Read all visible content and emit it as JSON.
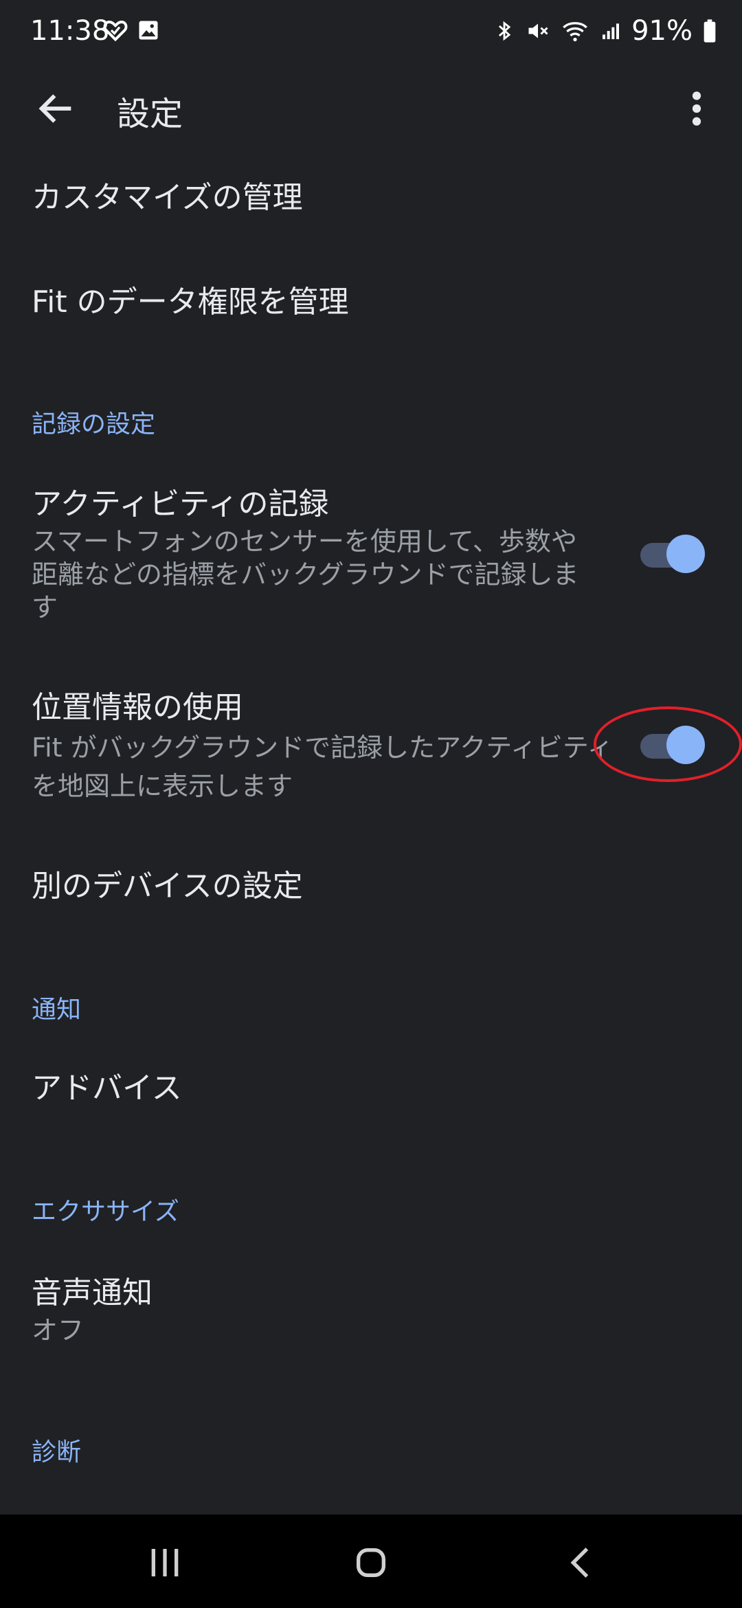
{
  "status_bar": {
    "time": "11:38",
    "battery_percent": "91%",
    "left_icons": [
      "heart-icon",
      "image-icon"
    ],
    "right_icons": [
      "bluetooth-icon",
      "mute-icon",
      "wifi-icon",
      "signal-icon",
      "battery-icon"
    ]
  },
  "app_bar": {
    "title": "設定",
    "back_icon": "arrow-back-icon",
    "menu_icon": "more-vert-icon"
  },
  "items": {
    "customize": {
      "title": "カスタマイズの管理"
    },
    "data_permissions": {
      "title": "Fit のデータ権限を管理"
    },
    "activity_recording": {
      "title": "アクティビティの記録",
      "subtitle": "スマートフォンのセンサーを使用して、歩数や距離などの指標をバックグラウンドで記録します",
      "enabled": true
    },
    "location": {
      "title": "位置情報の使用",
      "subtitle": "Fit がバックグラウンドで記録したアクティビティを地図上に表示します",
      "enabled": true
    },
    "other_device": {
      "title": "別のデバイスの設定"
    },
    "advice": {
      "title": "アドバイス"
    },
    "voice": {
      "title": "音声通知",
      "subtitle": "オフ"
    }
  },
  "sections": {
    "recording": "記録の設定",
    "notifications": "通知",
    "exercise": "エクササイズ",
    "diagnostics": "診断"
  },
  "colors": {
    "background": "#202124",
    "accent": "#8ab4f8",
    "annotation": "#e0202a"
  },
  "nav_bar": {
    "icons": [
      "recent-apps-icon",
      "home-icon",
      "back-icon"
    ]
  }
}
